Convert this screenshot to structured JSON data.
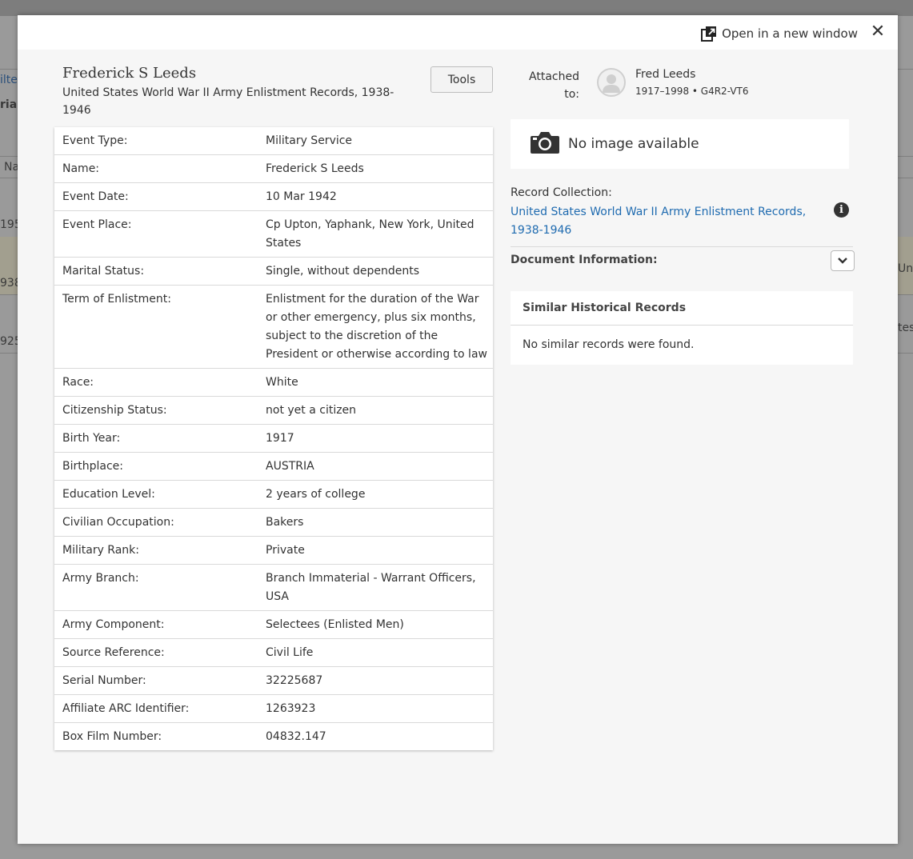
{
  "background": {
    "fragments": [
      "ilte",
      "ria",
      "Na",
      "195",
      "938",
      "925",
      "Unit",
      "tes"
    ]
  },
  "header": {
    "open_new_window_label": "Open in a new window",
    "close_label": "✕"
  },
  "record": {
    "person_name": "Frederick S Leeds",
    "collection_title": "United States World War II Army Enlistment Records, 1938-1946",
    "tools_label": "Tools"
  },
  "details": [
    {
      "label": "Event Type:",
      "value": "Military Service"
    },
    {
      "label": "Name:",
      "value": "Frederick S Leeds"
    },
    {
      "label": "Event Date:",
      "value": "10 Mar 1942"
    },
    {
      "label": "Event Place:",
      "value": "Cp Upton, Yaphank, New York, United States"
    },
    {
      "label": "Marital Status:",
      "value": "Single, without dependents"
    },
    {
      "label": "Term of Enlistment:",
      "value": "Enlistment for the duration of the War or other emergency, plus six months, subject to the discretion of the President or otherwise according to law"
    },
    {
      "label": "Race:",
      "value": "White"
    },
    {
      "label": "Citizenship Status:",
      "value": "not yet a citizen"
    },
    {
      "label": "Birth Year:",
      "value": "1917"
    },
    {
      "label": "Birthplace:",
      "value": "AUSTRIA"
    },
    {
      "label": "Education Level:",
      "value": "2 years of college"
    },
    {
      "label": "Civilian Occupation:",
      "value": "Bakers"
    },
    {
      "label": "Military Rank:",
      "value": "Private"
    },
    {
      "label": "Army Branch:",
      "value": "Branch Immaterial - Warrant Officers, USA"
    },
    {
      "label": "Army Component:",
      "value": "Selectees (Enlisted Men)"
    },
    {
      "label": "Source Reference:",
      "value": "Civil Life"
    },
    {
      "label": "Serial Number:",
      "value": "32225687"
    },
    {
      "label": "Affiliate ARC Identifier:",
      "value": "1263923"
    },
    {
      "label": "Box Film Number:",
      "value": "04832.147"
    }
  ],
  "attached": {
    "label": "Attached to:",
    "name": "Fred Leeds",
    "meta": "1917–1998 • G4R2-VT6"
  },
  "image": {
    "no_image_text": "No image available"
  },
  "record_collection": {
    "label": "Record Collection:",
    "link": "United States World War II Army Enlistment Records, 1938-1946"
  },
  "document_information": {
    "label": "Document Information:"
  },
  "similar_records": {
    "title": "Similar Historical Records",
    "empty_text": "No similar records were found."
  },
  "colors": {
    "link": "#1f6bb0",
    "overlay": "#9a9a9a"
  }
}
